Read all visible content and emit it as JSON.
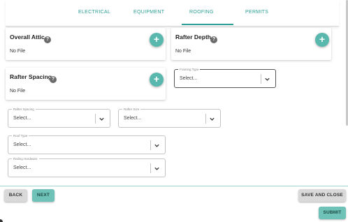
{
  "tabs": [
    {
      "label": "ELECTRICAL"
    },
    {
      "label": "EQUIPMENT"
    },
    {
      "label": "ROOFING"
    },
    {
      "label": "PERMITS"
    }
  ],
  "active_tab": "ROOFING",
  "cards": {
    "overall_attic": {
      "title": "Overall Attic",
      "help": "?",
      "status": "No File",
      "add": "+"
    },
    "rafter_depth": {
      "title": "Rafter Depth",
      "help": "?",
      "status": "No File",
      "add": "+"
    },
    "rafter_spacing": {
      "title": "Rafter Spacing",
      "help": "?",
      "status": "No File",
      "add": "+"
    }
  },
  "selects": {
    "framing_type": {
      "label": "Framing Type",
      "value": "Select..."
    },
    "rafter_spacing": {
      "label": "Rafter Spacing",
      "value": "Select..."
    },
    "rafter_size": {
      "label": "Rafter Size",
      "value": "Select..."
    },
    "roof_type": {
      "label": "Roof Type",
      "value": "Select..."
    },
    "railing_hardware": {
      "label": "Railing Hardware",
      "value": "Select..."
    }
  },
  "footer": {
    "back": "BACK",
    "next": "NEXT",
    "save_close": "SAVE AND CLOSE",
    "submit": "SUBMIT"
  },
  "colors": {
    "accent": "#2a9d95",
    "fab": "#59b8ad",
    "button_teal": "#6fc2b8",
    "button_grey": "#d9d9d9"
  }
}
